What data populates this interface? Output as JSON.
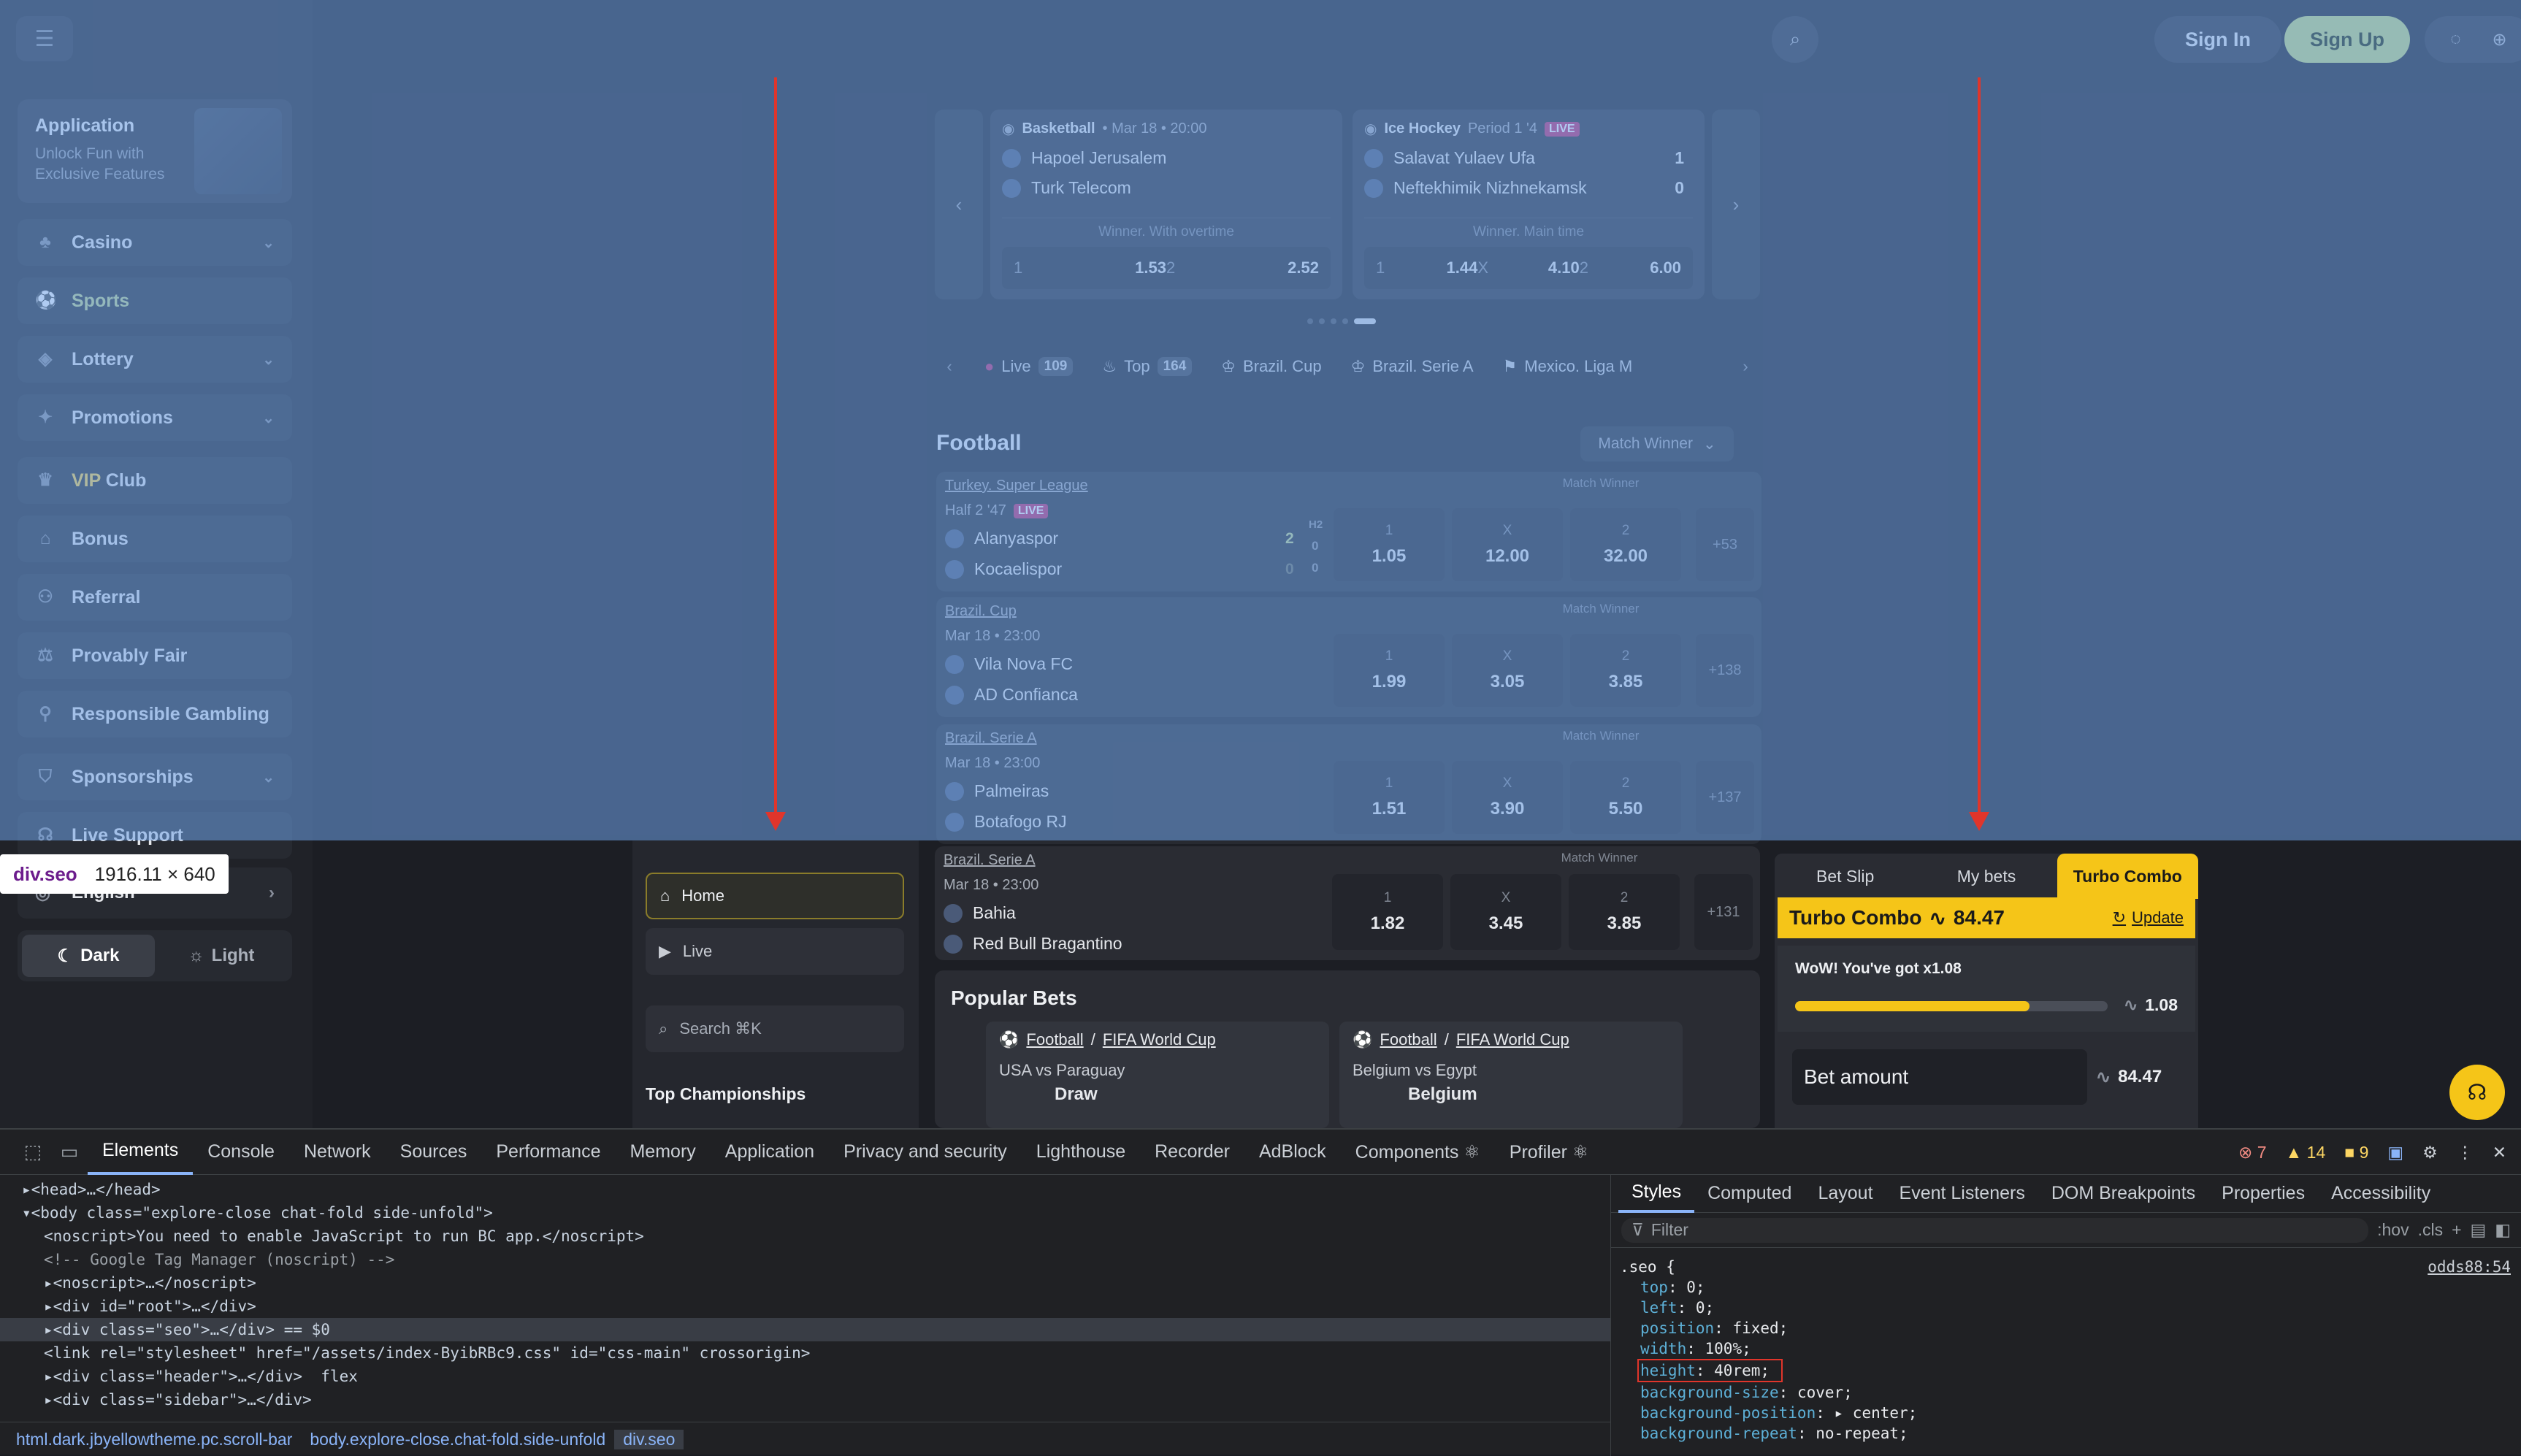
{
  "sidebar": {
    "app_card": {
      "title": "Application",
      "subtitle": "Unlock Fun with Exclusive Features"
    },
    "items": [
      {
        "label": "Casino",
        "icon": "casino-icon",
        "expandable": true
      },
      {
        "label": "Sports",
        "icon": "sports-icon",
        "expandable": false,
        "active": true
      },
      {
        "label": "Lottery",
        "icon": "lottery-icon",
        "expandable": true
      },
      {
        "label": "Promotions",
        "icon": "promotions-icon",
        "expandable": true
      },
      {
        "label_prefix": "VIP",
        "label": "Club",
        "icon": "vip-icon",
        "expandable": false
      },
      {
        "label": "Bonus",
        "icon": "gift-icon",
        "expandable": false
      },
      {
        "label": "Referral",
        "icon": "referral-icon",
        "expandable": false
      },
      {
        "label": "Provably Fair",
        "icon": "scale-icon",
        "expandable": false
      },
      {
        "label": "Responsible Gambling",
        "icon": "user-shield-icon",
        "expandable": false
      },
      {
        "label": "Sponsorships",
        "icon": "sponsor-icon",
        "expandable": true
      },
      {
        "label": "Live Support",
        "icon": "headset-icon",
        "expandable": false
      }
    ],
    "language": "English",
    "theme": {
      "dark": "Dark",
      "light": "Light",
      "selected": "dark"
    }
  },
  "header": {
    "sign_in": "Sign In",
    "sign_up": "Sign Up"
  },
  "featured": [
    {
      "sport": "Basketball",
      "meta": "Mar 18 • 20:00",
      "live": false,
      "team1": "Hapoel Jerusalem",
      "team2": "Turk Telecom",
      "score1": "",
      "score2": "",
      "market": "Winner. With overtime",
      "odds": [
        {
          "k": "1",
          "v": "1.53"
        },
        {
          "k": "2",
          "v": "2.52"
        }
      ]
    },
    {
      "sport": "Ice Hockey",
      "meta": "Period 1 '4",
      "live": true,
      "live_label": "LIVE",
      "team1": "Salavat Yulaev Ufa",
      "team2": "Neftekhimik Nizhnekamsk",
      "score1": "1",
      "score2": "0",
      "market": "Winner. Main time",
      "odds": [
        {
          "k": "1",
          "v": "1.44"
        },
        {
          "k": "X",
          "v": "4.10"
        },
        {
          "k": "2",
          "v": "6.00"
        }
      ]
    }
  ],
  "filters": [
    {
      "label": "Live",
      "count": "109",
      "icon": "live-dot-icon"
    },
    {
      "label": "Top",
      "count": "164",
      "icon": "fire-icon"
    },
    {
      "label": "Brazil. Cup",
      "count": "",
      "icon": "trophy-icon"
    },
    {
      "label": "Brazil. Serie A",
      "count": "",
      "icon": "trophy-icon"
    },
    {
      "label": "Mexico. Liga M",
      "count": "",
      "icon": "flag-icon"
    }
  ],
  "football": {
    "title": "Football",
    "market_select": "Match Winner",
    "matches": [
      {
        "league": "Turkey. Super League",
        "time": "Half 2 '47",
        "live": true,
        "live_label": "LIVE",
        "team1": "Alanyaspor",
        "team2": "Kocaelispor",
        "score1": "2",
        "score2": "0",
        "h2_label": "H2",
        "h2_1": "0",
        "h2_2": "0",
        "market": "Match Winner",
        "odds": [
          {
            "k": "1",
            "v": "1.05"
          },
          {
            "k": "X",
            "v": "12.00"
          },
          {
            "k": "2",
            "v": "32.00"
          }
        ],
        "more": "+53"
      },
      {
        "league": "Brazil. Cup",
        "time": "Mar 18 • 23:00",
        "live": false,
        "team1": "Vila Nova FC",
        "team2": "AD Confianca",
        "market": "Match Winner",
        "odds": [
          {
            "k": "1",
            "v": "1.99"
          },
          {
            "k": "X",
            "v": "3.05"
          },
          {
            "k": "2",
            "v": "3.85"
          }
        ],
        "more": "+138"
      },
      {
        "league": "Brazil. Serie A",
        "time": "Mar 18 • 23:00",
        "live": false,
        "team1": "Palmeiras",
        "team2": "Botafogo RJ",
        "market": "Match Winner",
        "odds": [
          {
            "k": "1",
            "v": "1.51"
          },
          {
            "k": "X",
            "v": "3.90"
          },
          {
            "k": "2",
            "v": "5.50"
          }
        ],
        "more": "+137"
      }
    ]
  },
  "tooltip": {
    "element": "div.seo",
    "size": "1916.11 × 640"
  },
  "lower": {
    "home": "Home",
    "live": "Live",
    "search": "Search ⌘K",
    "top_championships": "Top Championships",
    "match": {
      "league": "Brazil. Serie A",
      "time": "Mar 18 • 23:00",
      "team1": "Bahia",
      "team2": "Red Bull Bragantino",
      "market": "Match Winner",
      "odds": [
        {
          "k": "1",
          "v": "1.82"
        },
        {
          "k": "X",
          "v": "3.45"
        },
        {
          "k": "2",
          "v": "3.85"
        }
      ],
      "more": "+131"
    },
    "popular_title": "Popular Bets",
    "popular": [
      {
        "sport": "Football",
        "league": "FIFA World Cup",
        "match": "USA vs Paraguay",
        "pick": "Draw"
      },
      {
        "sport": "Football",
        "league": "FIFA World Cup",
        "match": "Belgium vs Egypt",
        "pick": "Belgium"
      }
    ]
  },
  "betslip": {
    "tabs": [
      "Bet Slip",
      "My bets",
      "Turbo Combo"
    ],
    "active_tab": "Turbo Combo",
    "title": "Turbo Combo",
    "value": "84.47",
    "update": "Update",
    "bonus_text": "WoW! You've got x1.08",
    "multiplier": "1.08",
    "progress": 0.75,
    "amount_label": "Bet amount",
    "amount_value": "84.47"
  },
  "devtools": {
    "tabs": [
      "Elements",
      "Console",
      "Network",
      "Sources",
      "Performance",
      "Memory",
      "Application",
      "Privacy and security",
      "Lighthouse",
      "Recorder",
      "AdBlock",
      "Components ⚛",
      "Profiler ⚛"
    ],
    "active_tab": "Elements",
    "errors": "7",
    "warnings": "14",
    "issues": "9",
    "dom_lines": [
      {
        "text": "▸<head>…</head>",
        "indent": 0
      },
      {
        "text": "▾<body class=\"explore-close chat-fold side-unfold\">",
        "indent": 0
      },
      {
        "text": "<noscript>You need to enable JavaScript to run BC app.</noscript>",
        "indent": 1
      },
      {
        "text": "<!-- Google Tag Manager (noscript) -->",
        "indent": 1
      },
      {
        "text": "▸<noscript>…</noscript>",
        "indent": 1
      },
      {
        "text": "▸<div id=\"root\">…</div>",
        "indent": 1
      },
      {
        "text": "▸<div class=\"seo\">…</div> == $0",
        "indent": 1,
        "selected": true
      },
      {
        "text": "<link rel=\"stylesheet\" href=\"/assets/index-ByibRBc9.css\" id=\"css-main\" crossorigin>",
        "indent": 1
      },
      {
        "text": "▸<div class=\"header\">…</div>  flex",
        "indent": 1
      },
      {
        "text": "▸<div class=\"sidebar\">…</div>",
        "indent": 1
      }
    ],
    "breadcrumbs": [
      "html.dark.jbyellowtheme.pc.scroll-bar",
      "body.explore-close.chat-fold.side-unfold",
      "div.seo"
    ],
    "style_tabs": [
      "Styles",
      "Computed",
      "Layout",
      "Event Listeners",
      "DOM Breakpoints",
      "Properties",
      "Accessibility"
    ],
    "active_style_tab": "Styles",
    "filter_placeholder": "Filter",
    "hov": ":hov",
    "cls": ".cls",
    "rule": {
      "selector": ".seo {",
      "source": "odds88:54",
      "props": [
        {
          "name": "top",
          "value": "0;"
        },
        {
          "name": "left",
          "value": "0;"
        },
        {
          "name": "position",
          "value": "fixed;"
        },
        {
          "name": "width",
          "value": "100%;"
        },
        {
          "name": "height",
          "value": "40rem;",
          "highlight": true
        },
        {
          "name": "background-size",
          "value": "cover;"
        },
        {
          "name": "background-position",
          "value": "▸ center;"
        },
        {
          "name": "background-repeat",
          "value": "no-repeat;"
        }
      ]
    }
  }
}
